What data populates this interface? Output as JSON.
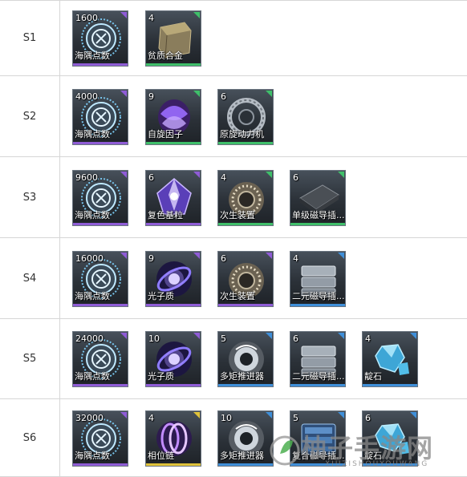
{
  "rows": [
    {
      "stage": "S1",
      "items": [
        {
          "count": "1600",
          "name": "海隅点数",
          "icon": "gear-coin-icon",
          "rarity": "purple"
        },
        {
          "count": "4",
          "name": "贫质合金",
          "icon": "alloy-block-icon",
          "rarity": "green"
        }
      ]
    },
    {
      "stage": "S2",
      "items": [
        {
          "count": "4000",
          "name": "海隅点数",
          "icon": "gear-coin-icon",
          "rarity": "purple"
        },
        {
          "count": "9",
          "name": "自旋因子",
          "icon": "spin-factor-icon",
          "rarity": "green"
        },
        {
          "count": "6",
          "name": "原旋动力机",
          "icon": "turbine-ring-icon",
          "rarity": "green"
        }
      ]
    },
    {
      "stage": "S3",
      "items": [
        {
          "count": "9600",
          "name": "海隅点数",
          "icon": "gear-coin-icon",
          "rarity": "purple"
        },
        {
          "count": "6",
          "name": "复色基粒",
          "icon": "crystal-gem-icon",
          "rarity": "purple"
        },
        {
          "count": "4",
          "name": "次生装置",
          "icon": "secondary-device-icon",
          "rarity": "green"
        },
        {
          "count": "6",
          "name": "单级磁导插...",
          "icon": "magnetic-plate-icon",
          "rarity": "green"
        }
      ]
    },
    {
      "stage": "S4",
      "items": [
        {
          "count": "16000",
          "name": "海隅点数",
          "icon": "gear-coin-icon",
          "rarity": "purple"
        },
        {
          "count": "9",
          "name": "光子质",
          "icon": "photon-orb-icon",
          "rarity": "purple"
        },
        {
          "count": "6",
          "name": "次生装置",
          "icon": "secondary-device-icon",
          "rarity": "purple"
        },
        {
          "count": "4",
          "name": "二元磁导插...",
          "icon": "magnetic-block-icon",
          "rarity": "blue"
        }
      ]
    },
    {
      "stage": "S5",
      "items": [
        {
          "count": "24000",
          "name": "海隅点数",
          "icon": "gear-coin-icon",
          "rarity": "purple"
        },
        {
          "count": "10",
          "name": "光子质",
          "icon": "photon-orb-icon",
          "rarity": "purple"
        },
        {
          "count": "5",
          "name": "多矩推进器",
          "icon": "thruster-icon",
          "rarity": "blue"
        },
        {
          "count": "6",
          "name": "二元磁导插...",
          "icon": "magnetic-block-icon",
          "rarity": "blue"
        },
        {
          "count": "4",
          "name": "靛石",
          "icon": "indigo-stone-icon",
          "rarity": "blue"
        }
      ]
    },
    {
      "stage": "S6",
      "items": [
        {
          "count": "32000",
          "name": "海隅点数",
          "icon": "gear-coin-icon",
          "rarity": "purple"
        },
        {
          "count": "4",
          "name": "相位链",
          "icon": "phase-chain-icon",
          "rarity": "yellow"
        },
        {
          "count": "10",
          "name": "多矩推进器",
          "icon": "thruster-icon",
          "rarity": "blue"
        },
        {
          "count": "5",
          "name": "复合磁导插...",
          "icon": "composite-magnet-icon",
          "rarity": "blue"
        },
        {
          "count": "6",
          "name": "靛石",
          "icon": "indigo-stone-icon",
          "rarity": "blue"
        }
      ]
    }
  ],
  "colors": {
    "purple": "#8f5cd6",
    "green": "#3fbf6a",
    "blue": "#3f8fd9",
    "yellow": "#e0c23a"
  },
  "watermark": {
    "text": "柚子手游网",
    "sub": "XIUZISHOUYOUWANG"
  }
}
